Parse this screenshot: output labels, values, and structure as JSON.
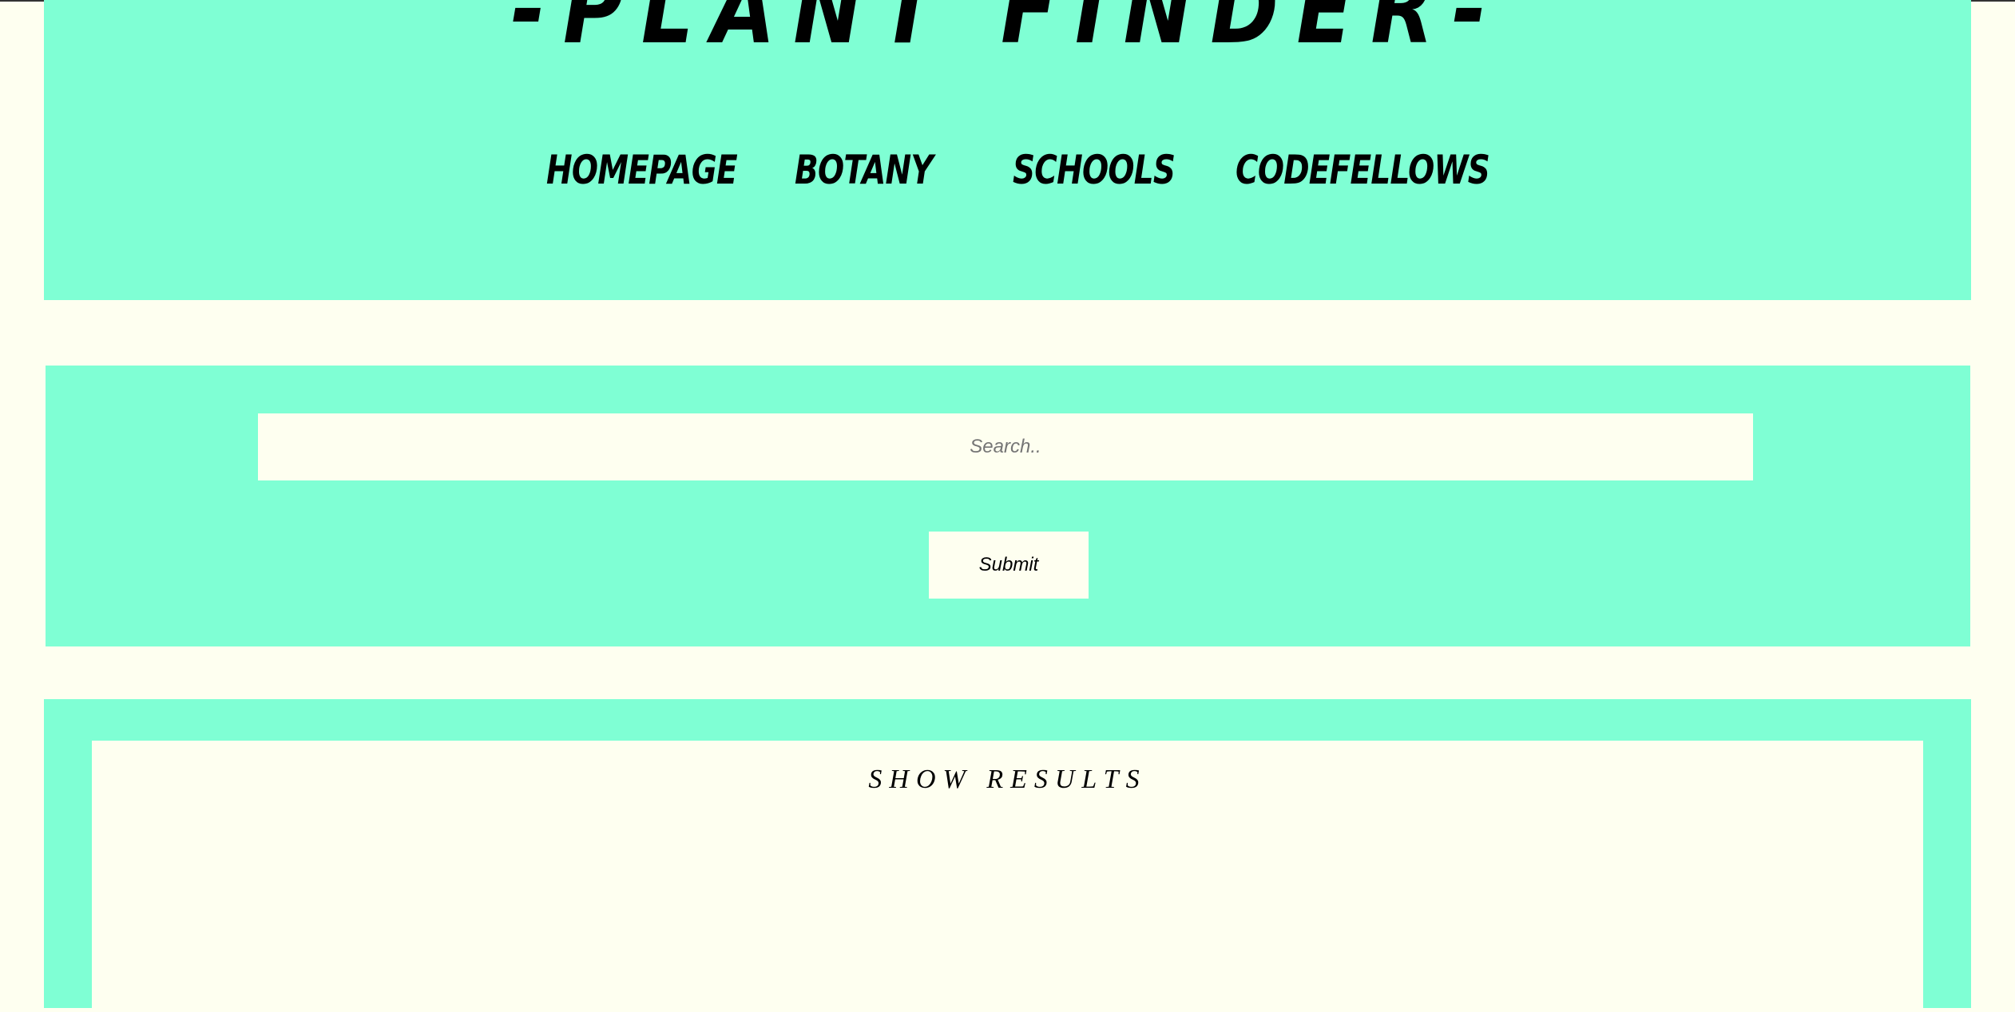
{
  "header": {
    "title": "-PLANT FINDER-",
    "nav": [
      {
        "label": "HOMEPAGE"
      },
      {
        "label": "BOTANY"
      },
      {
        "label": "SCHOOLS"
      },
      {
        "label": "CODEFELLOWS"
      }
    ]
  },
  "search": {
    "placeholder": "Search..",
    "value": "",
    "submit_label": "Submit"
  },
  "results": {
    "heading": "SHOW RESULTS"
  },
  "colors": {
    "panel": "#7fffd4",
    "background": "#fefff0",
    "text": "#000000"
  }
}
